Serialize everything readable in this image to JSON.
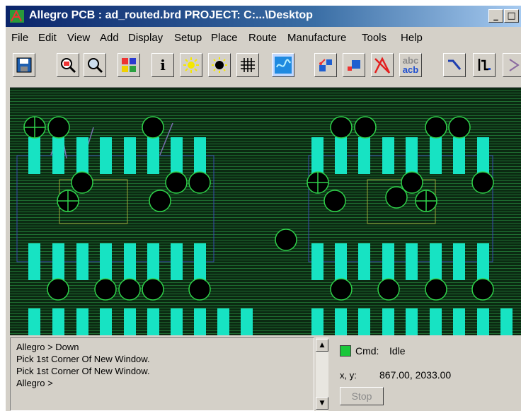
{
  "window": {
    "title": "Allegro PCB : ad_routed.brd  PROJECT: C:...\\Desktop",
    "minimize_glyph": "_",
    "maximize_glyph": "□"
  },
  "menubar": {
    "items": [
      "File",
      "Edit",
      "View",
      "Add",
      "Display",
      "Setup",
      "Place",
      "Route",
      "Manufacture",
      "Tools",
      "Help"
    ]
  },
  "toolbar": {
    "buttons": [
      {
        "icon": "save-icon"
      },
      {
        "icon": "zoom-fit-icon"
      },
      {
        "icon": "zoom-icon"
      },
      {
        "icon": "color-palette-icon"
      },
      {
        "icon": "info-icon",
        "glyph": "i"
      },
      {
        "icon": "light-on-icon"
      },
      {
        "icon": "light-off-icon"
      },
      {
        "icon": "grid-icon"
      },
      {
        "icon": "unrats-icon"
      },
      {
        "icon": "swap-pins-icon"
      },
      {
        "icon": "move-component-icon"
      },
      {
        "icon": "delete-icon"
      },
      {
        "icon": "change-text-icon",
        "glyph_top": "abc",
        "glyph_bottom": "acb"
      },
      {
        "icon": "add-connect-icon"
      },
      {
        "icon": "slide-icon"
      },
      {
        "icon": "more-icon"
      }
    ]
  },
  "colors": {
    "board_background": "#0b2a12",
    "trace": "#1e6b30",
    "pad": "#17e3c3",
    "via": "#000000",
    "via_outline": "#2fd14a",
    "outline": "#9aa43a",
    "silkscreen": "#7a6fb0"
  },
  "command_window": {
    "lines": [
      "Allegro > Down",
      "Pick 1st Corner Of New Window.",
      "Pick 1st Corner Of New Window.",
      "Allegro >"
    ]
  },
  "status": {
    "cmd_label": "Cmd:",
    "cmd_value": "Idle",
    "indicator_color": "#19c73a",
    "xy_label": "x, y:",
    "xy_value": "867.00, 2033.00",
    "stop_label": "Stop"
  }
}
